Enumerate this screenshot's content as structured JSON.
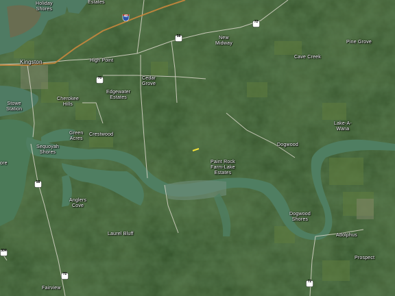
{
  "map": {
    "type": "satellite",
    "places": {
      "holiday_shores": "Holiday\nShores",
      "estates_top": "Estates",
      "kingston": "Kingston",
      "high_point": "High Point",
      "new_midway": "New\nMidway",
      "pine_grove": "Pine Grove",
      "cave_creek": "Cave Creek",
      "stowe_station": "Stowe\nStation",
      "cherokee_hills": "Cherokee\nHills",
      "edgewater_estates": "Edgewater\nEstates",
      "cedar_grove": "Cedar\nGrove",
      "lake_a_wana": "Lake-A-\nWana",
      "green_acres": "Green\nAcres",
      "crestwood": "Crestwood",
      "sequoyah_shores": "Sequoyah\nShores",
      "dogwood": "Dogwood",
      "paint_rock": "Paint Rock\nFarm-Lake\nEstates",
      "ore": "ore",
      "anglers_cove": "Anglers\nCove",
      "dogwood_shores": "Dogwood\nShores",
      "laurel_bluff": "Laurel Bluff",
      "adolphus": "Adolphus",
      "prospect": "Prospect",
      "fairview": "Fairview"
    },
    "shields": {
      "i40": "40",
      "r58_top": "58",
      "r72_top": "72",
      "r70": "70",
      "r58_mid": "58",
      "r72_low": "72",
      "r72_right": "72",
      "r304": "304"
    },
    "colors": {
      "river": "#4e7a5f",
      "river_light": "#6d8f7a",
      "forest_dark": "#1f3a1c",
      "forest": "#2f5227",
      "field": "#5e7a3c",
      "road": "#d9d9d0",
      "interstate": "#d08a3c",
      "label": "#ffffff"
    }
  }
}
